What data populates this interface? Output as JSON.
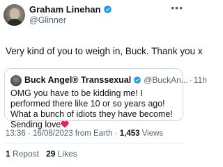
{
  "author": {
    "display_name": "Graham Linehan",
    "handle": "@Glinner",
    "verified": true,
    "verified_color": "#1d9bf0"
  },
  "tweet": {
    "text": "Very kind of you to weigh in, Buck. Thank you x",
    "more_icon": "more-horizontal-icon"
  },
  "quoted": {
    "display_name": "Buck Angel® Transsexual",
    "handle": "@BuckAn...",
    "separator": "·",
    "time": "11h",
    "verified": true,
    "text": "OMG you have to be kidding me! I performed there like 10 or so years ago! What a bunch of idiots they have become! Sending love",
    "emoji": "red-heart-icon"
  },
  "meta": {
    "time": "13:36",
    "date": "16/08/2023",
    "source": "from Earth",
    "views_count": "1,453",
    "views_label": "Views",
    "separator": "·"
  },
  "stats": {
    "reposts_count": "1",
    "reposts_label": "Repost",
    "likes_count": "29",
    "likes_label": "Likes"
  },
  "colors": {
    "primary_text": "#0f1419",
    "secondary_text": "#536471",
    "border": "#cfd9de",
    "heart": "#e0245e"
  }
}
